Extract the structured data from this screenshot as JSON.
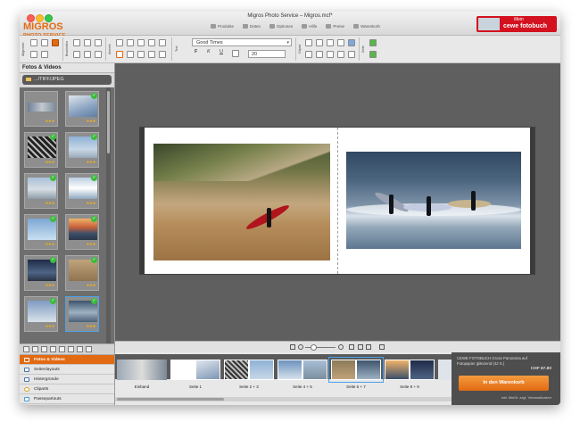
{
  "window": {
    "title": "Migros Photo Service – Migros.mcf*"
  },
  "brand": {
    "name": "MIGROS",
    "sub": "PHOTO SERVICE"
  },
  "topnav": [
    "Produkte",
    "Daten",
    "Optionen",
    "Hilfe",
    "Preise",
    "Warenkorb"
  ],
  "cewe": {
    "mein": "Mein",
    "name": "cewe fotobuch"
  },
  "toolbar": {
    "labels": [
      "Allgemein",
      "Bearbeiten",
      "Ansicht",
      "Text",
      "Objekt",
      "Seite"
    ],
    "font": "Good Times",
    "font_size": "20",
    "format_buttons": [
      "F",
      "K",
      "U"
    ]
  },
  "left_panel": {
    "header": "Fotos & Videos",
    "folder": ".../TIFF/JPEG",
    "stars": "★★★"
  },
  "nav": [
    "Fotos & Videos",
    "Seitenlayouts",
    "Hintergründe",
    "Cliparts",
    "Passepartouts"
  ],
  "filmstrip": {
    "labels": [
      "Einband",
      "Seite 1",
      "Seite 2 + 3",
      "Seite 4 + 5",
      "Seite 6 + 7",
      "Seite 8 + 9"
    ]
  },
  "order": {
    "description": "CEWE FOTOBUCH Gross Panorama auf Fotopapier glänzend (42 S.)",
    "price": "CHF 87.80",
    "cart_button": "In den Warenkorb",
    "vat_note": "inkl. MwSt. zzgl. Versandkosten"
  },
  "colors": {
    "accent": "#e26a12",
    "cewe_red": "#d3111f",
    "check": "#3cbc3a"
  }
}
